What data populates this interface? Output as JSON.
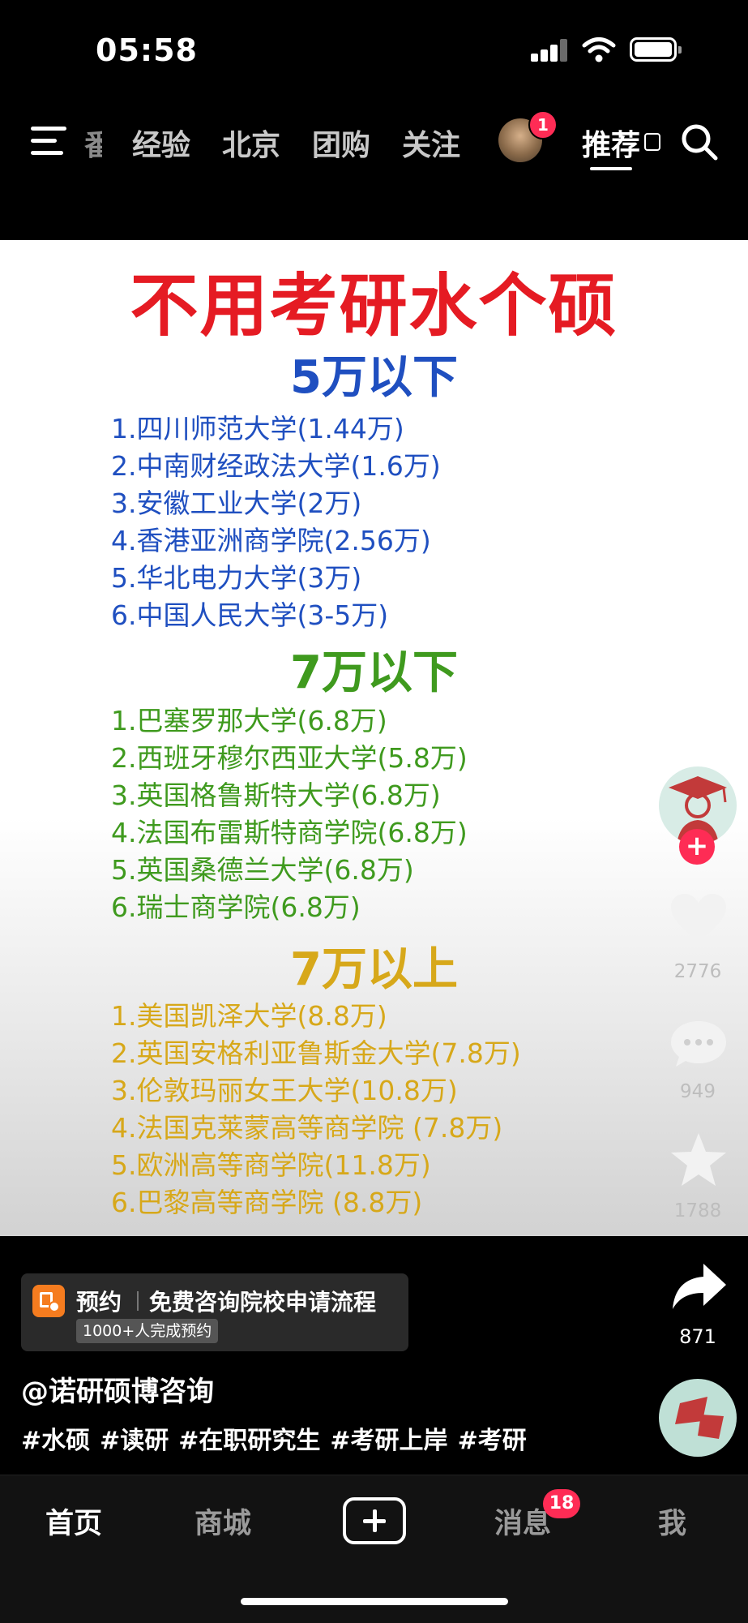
{
  "status_bar": {
    "time": "05:58"
  },
  "top_nav": {
    "tabs": [
      "经验",
      "北京",
      "团购",
      "关注"
    ],
    "partial_tab": "番",
    "avatar_badge": "1",
    "active_tab": "推荐"
  },
  "post": {
    "headline": "不用考研水个硕",
    "sections": [
      {
        "heading": "5万以下",
        "color": "#1f4fc0",
        "items": [
          "1.四川师范大学(1.44万)",
          "2.中南财经政法大学(1.6万)",
          "3.安徽工业大学(2万)",
          "4.香港亚洲商学院(2.56万)",
          "5.华北电力大学(3万)",
          "6.中国人民大学(3-5万)"
        ]
      },
      {
        "heading": "7万以下",
        "color": "#3f9a1e",
        "items": [
          "1.巴塞罗那大学(6.8万)",
          "2.西班牙穆尔西亚大学(5.8万)",
          "3.英国格鲁斯特大学(6.8万)",
          "4.法国布雷斯特商学院(6.8万)",
          "5.英国桑德兰大学(6.8万)",
          "6.瑞士商学院(6.8万)"
        ]
      },
      {
        "heading": "7万以上",
        "color": "#d7a81a",
        "items": [
          "1.美国凯泽大学(8.8万)",
          "2.英国安格利亚鲁斯金大学(7.8万)",
          "3.伦敦玛丽女王大学(10.8万)",
          "4.法国克莱蒙高等商学院 (7.8万)",
          "5.欧洲高等商学院(11.8万)",
          "6.巴黎高等商学院 (8.8万)"
        ]
      }
    ]
  },
  "right_rail": {
    "likes": "2776",
    "comments": "949",
    "favorites": "1788",
    "shares": "871"
  },
  "booking": {
    "label": "预约",
    "title": "免费咨询院校申请流程",
    "sub": "1000+人完成预约"
  },
  "author": "@诺研硕博咨询",
  "hashtags": [
    "#水硕",
    "#读研",
    "#在职研究生",
    "#考研上岸",
    "#考研"
  ],
  "bottom_tabs": {
    "home": "首页",
    "mall": "商城",
    "messages": "消息",
    "messages_badge": "18",
    "me": "我"
  },
  "colors": {
    "accent_red": "#fe2c55",
    "headline_red": "#e51b23",
    "booking_orange": "#f57c1f"
  }
}
